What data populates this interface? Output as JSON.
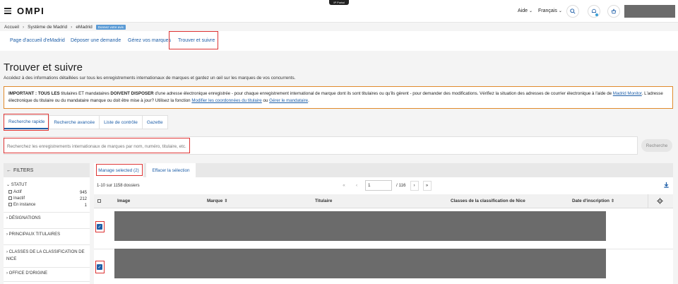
{
  "header": {
    "logo": "OMPI",
    "portal_tag": "IP Portal",
    "help_label": "Aide",
    "language_label": "Français"
  },
  "breadcrumb": {
    "items": [
      "Accueil",
      "Système de Madrid",
      "eMadrid"
    ],
    "feedback_badge": "Donnez votre avis"
  },
  "subnav": {
    "items": [
      "Page d'accueil d'eMadrid",
      "Déposer une demande",
      "Gérez vos marques",
      "Trouver et suivre"
    ]
  },
  "page": {
    "title": "Trouver et suivre",
    "description": "Accédez à des informations détaillées sur tous les enregistrements internationaux de marques et gardez un œil sur les marques de vos concurrents."
  },
  "important": {
    "lead": "IMPORTANT : TOUS LES",
    "text1": " titulaires ET mandataires ",
    "bold2": "DOIVENT DISPOSER",
    "text2": " d'une adresse électronique enregistrée - pour chaque enregistrement international de marque dont ils sont titulaires ou qu'ils gèrent - pour demander des modifications. Vérifiez la situation des adresses de courrier électronique à l'aide de ",
    "link1": "Madrid Monitor",
    "text3": ". L'adresse électronique du titulaire ou du mandataire manque ou doit être mise à jour? Utilisez la fonction ",
    "link2": "Modifier les coordonnées du titulaire",
    "text4": " ou ",
    "link3": "Gérer le mandataire",
    "text5": "."
  },
  "search_tabs": [
    "Recherche rapide",
    "Recherche avancée",
    "Liste de contrôle",
    "Gazette"
  ],
  "search": {
    "placeholder": "Recherchez les enregistrements internationaux de marques par nom, numéro, titulaire, etc.",
    "button_label": "Recherche"
  },
  "filters": {
    "title": "FILTERS",
    "statut_label": "STATUT",
    "statut_options": [
      {
        "label": "Actif",
        "count": "945"
      },
      {
        "label": "Inactif",
        "count": "212"
      },
      {
        "label": "En instance",
        "count": "1"
      }
    ],
    "sections": [
      "DÉSIGNATIONS",
      "PRINCIPAUX TITULAIRES",
      "CLASSES DE LA CLASSIFICATION DE NICE",
      "OFFICE D'ORIGINE"
    ]
  },
  "results": {
    "manage_label": "Manage selected (2)",
    "clear_label": "Effacer la sélection",
    "count_text": "1-10 sur 1158 dossiers",
    "page_value": "1",
    "page_total": "/ 116",
    "columns": [
      "Image",
      "Marque",
      "Titulaire",
      "Classes de la classification de Nice",
      "Date d'inscription"
    ]
  },
  "colors": {
    "accent": "#1f5fa8",
    "highlight_box": "#dd3333",
    "important_border": "#e08a2c",
    "redacted": "#6b6b6b"
  }
}
